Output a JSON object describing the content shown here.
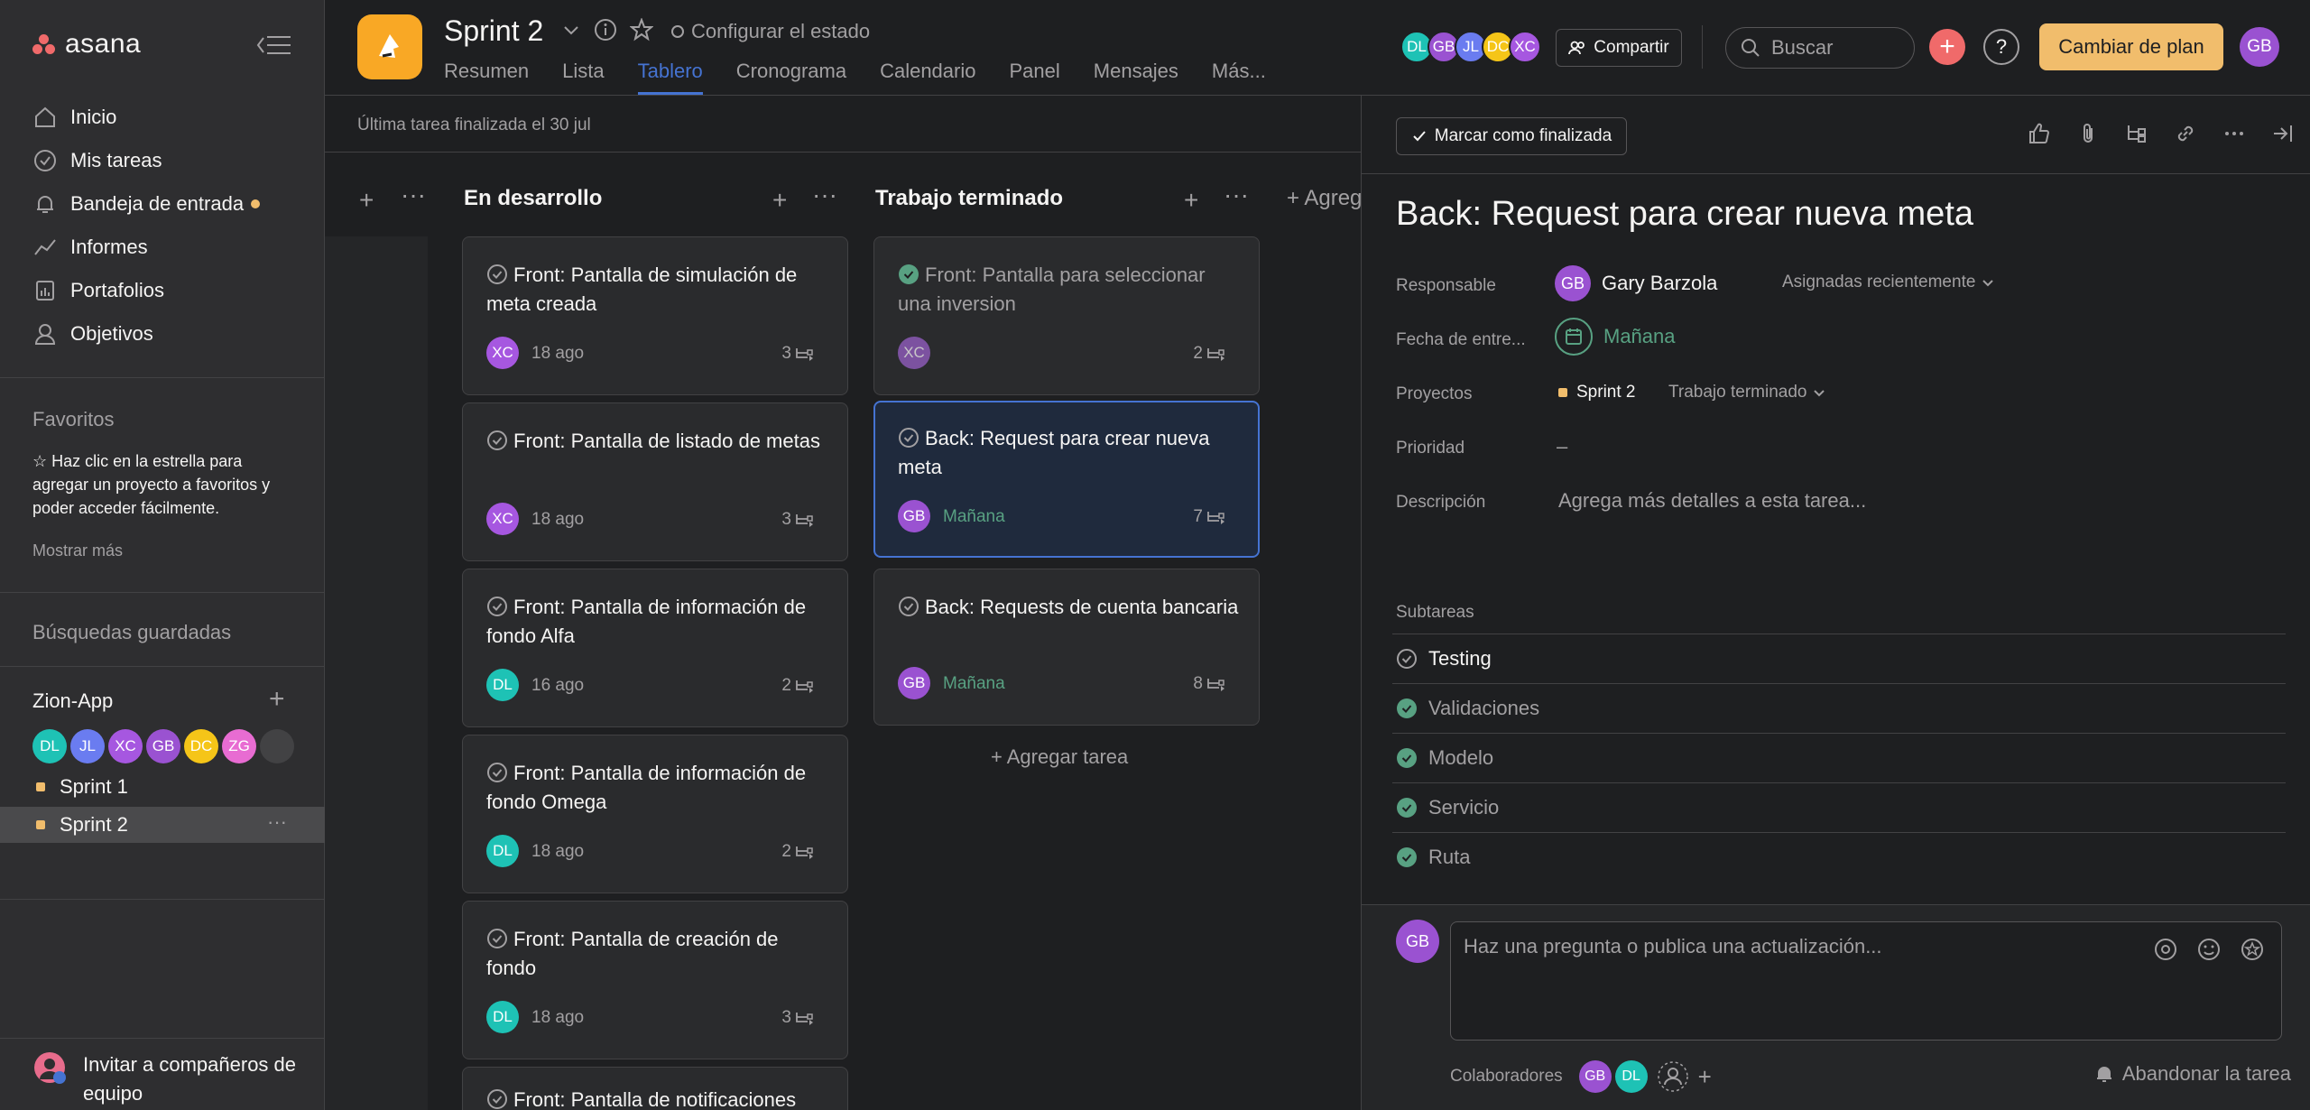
{
  "colors": {
    "accent_blue": "#4573d2",
    "brand_coral": "#f06a6a",
    "upgrade_yellow": "#f1bd6c",
    "success_green": "#58a182"
  },
  "sidebar": {
    "logo": "asana",
    "nav": [
      {
        "label": "Inicio",
        "icon": "home-icon"
      },
      {
        "label": "Mis tareas",
        "icon": "check-circle-icon"
      },
      {
        "label": "Bandeja de entrada",
        "icon": "bell-icon"
      },
      {
        "label": "Informes",
        "icon": "chart-line-icon"
      },
      {
        "label": "Portafolios",
        "icon": "folder-icon"
      },
      {
        "label": "Objetivos",
        "icon": "person-icon"
      }
    ],
    "favorites_heading": "Favoritos",
    "favorites_hint": "☆ Haz clic en la estrella para agregar un proyecto a favoritos y poder acceder fácilmente.",
    "show_more": "Mostrar más",
    "saved_searches": "Búsquedas guardadas",
    "team_name": "Zion-App",
    "team_members": [
      {
        "initials": "DL",
        "color": "#1ec2b5"
      },
      {
        "initials": "JL",
        "color": "#6a7cf0"
      },
      {
        "initials": "XC",
        "color": "#a657e0"
      },
      {
        "initials": "GB",
        "color": "#9a52d1"
      },
      {
        "initials": "DC",
        "color": "#f5c518"
      },
      {
        "initials": "ZG",
        "color": "#e86cd2"
      }
    ],
    "projects": [
      {
        "label": "Sprint 1"
      },
      {
        "label": "Sprint 2"
      }
    ],
    "invite": "Invitar a compañeros de equipo"
  },
  "header": {
    "project_title": "Sprint 2",
    "set_status": "Configurar el estado",
    "tabs": [
      "Resumen",
      "Lista",
      "Tablero",
      "Cronograma",
      "Calendario",
      "Panel",
      "Mensajes",
      "Más..."
    ],
    "active_tab": "Tablero",
    "members": [
      {
        "initials": "DL",
        "color": "#1ec2b5"
      },
      {
        "initials": "GB",
        "color": "#9a52d1"
      },
      {
        "initials": "JL",
        "color": "#6a7cf0"
      },
      {
        "initials": "DC",
        "color": "#f5c518"
      },
      {
        "initials": "XC",
        "color": "#a657e0"
      }
    ],
    "share_label": "Compartir",
    "search_placeholder": "Buscar",
    "upgrade_label": "Cambiar de plan",
    "me_initials": "GB"
  },
  "board": {
    "last_completed": "Última tarea finalizada el 30 jul",
    "columns": [
      {
        "title": "En desarrollo",
        "cards": [
          {
            "title": "Front: Pantalla de simulación de meta creada",
            "assignee": "XC",
            "assignee_color": "#a657e0",
            "due": "18 ago",
            "subtasks": "3"
          },
          {
            "title": "Front: Pantalla de listado de metas",
            "assignee": "XC",
            "assignee_color": "#a657e0",
            "due": "18 ago",
            "subtasks": "3"
          },
          {
            "title": "Front: Pantalla de información de fondo Alfa",
            "assignee": "DL",
            "assignee_color": "#1ec2b5",
            "due": "16 ago",
            "subtasks": "2"
          },
          {
            "title": "Front: Pantalla de información de fondo Omega",
            "assignee": "DL",
            "assignee_color": "#1ec2b5",
            "due": "18 ago",
            "subtasks": "2"
          },
          {
            "title": "Front: Pantalla de creación de fondo",
            "assignee": "DL",
            "assignee_color": "#1ec2b5",
            "due": "18 ago",
            "subtasks": "3"
          },
          {
            "title": "Front: Pantalla de notificaciones",
            "assignee": "",
            "assignee_color": "#1ec2b5",
            "due": "",
            "subtasks": ""
          }
        ]
      },
      {
        "title": "Trabajo terminado",
        "cards": [
          {
            "title": "Front: Pantalla para seleccionar una inversion",
            "assignee": "XC",
            "assignee_color": "#7c52a0",
            "due": "",
            "subtasks": "2",
            "completed": true
          },
          {
            "title": "Back: Request para crear nueva meta",
            "assignee": "GB",
            "assignee_color": "#9a52d1",
            "due": "Mañana",
            "subtasks": "7",
            "selected": true
          },
          {
            "title": "Back: Requests de cuenta bancaria",
            "assignee": "GB",
            "assignee_color": "#9a52d1",
            "due": "Mañana",
            "subtasks": "8"
          }
        ]
      }
    ],
    "add_task": "+ Agregar tarea",
    "add_section": "+ Agreg"
  },
  "detail": {
    "mark_complete": "Marcar como finalizada",
    "title": "Back: Request para crear nueva meta",
    "fields": {
      "assignee_label": "Responsable",
      "assignee_initials": "GB",
      "assignee_name": "Gary Barzola",
      "recent_assigned": "Asignadas recientemente",
      "due_label": "Fecha de entre...",
      "due_value": "Mañana",
      "projects_label": "Proyectos",
      "project_name": "Sprint 2",
      "project_section": "Trabajo terminado",
      "priority_label": "Prioridad",
      "priority_value": "–",
      "description_label": "Descripción",
      "description_placeholder": "Agrega más detalles a esta tarea..."
    },
    "subtasks_label": "Subtareas",
    "subtasks": [
      {
        "label": "Testing",
        "done": false
      },
      {
        "label": "Validaciones",
        "done": true
      },
      {
        "label": "Modelo",
        "done": true
      },
      {
        "label": "Servicio",
        "done": true
      },
      {
        "label": "Ruta",
        "done": true
      }
    ],
    "comment_placeholder": "Haz una pregunta o publica una actualización...",
    "commenter_initials": "GB",
    "collaborators_label": "Colaboradores",
    "collaborators": [
      {
        "initials": "GB",
        "color": "#9a52d1"
      },
      {
        "initials": "DL",
        "color": "#1ec2b5"
      }
    ],
    "leave_task": "Abandonar la tarea"
  }
}
